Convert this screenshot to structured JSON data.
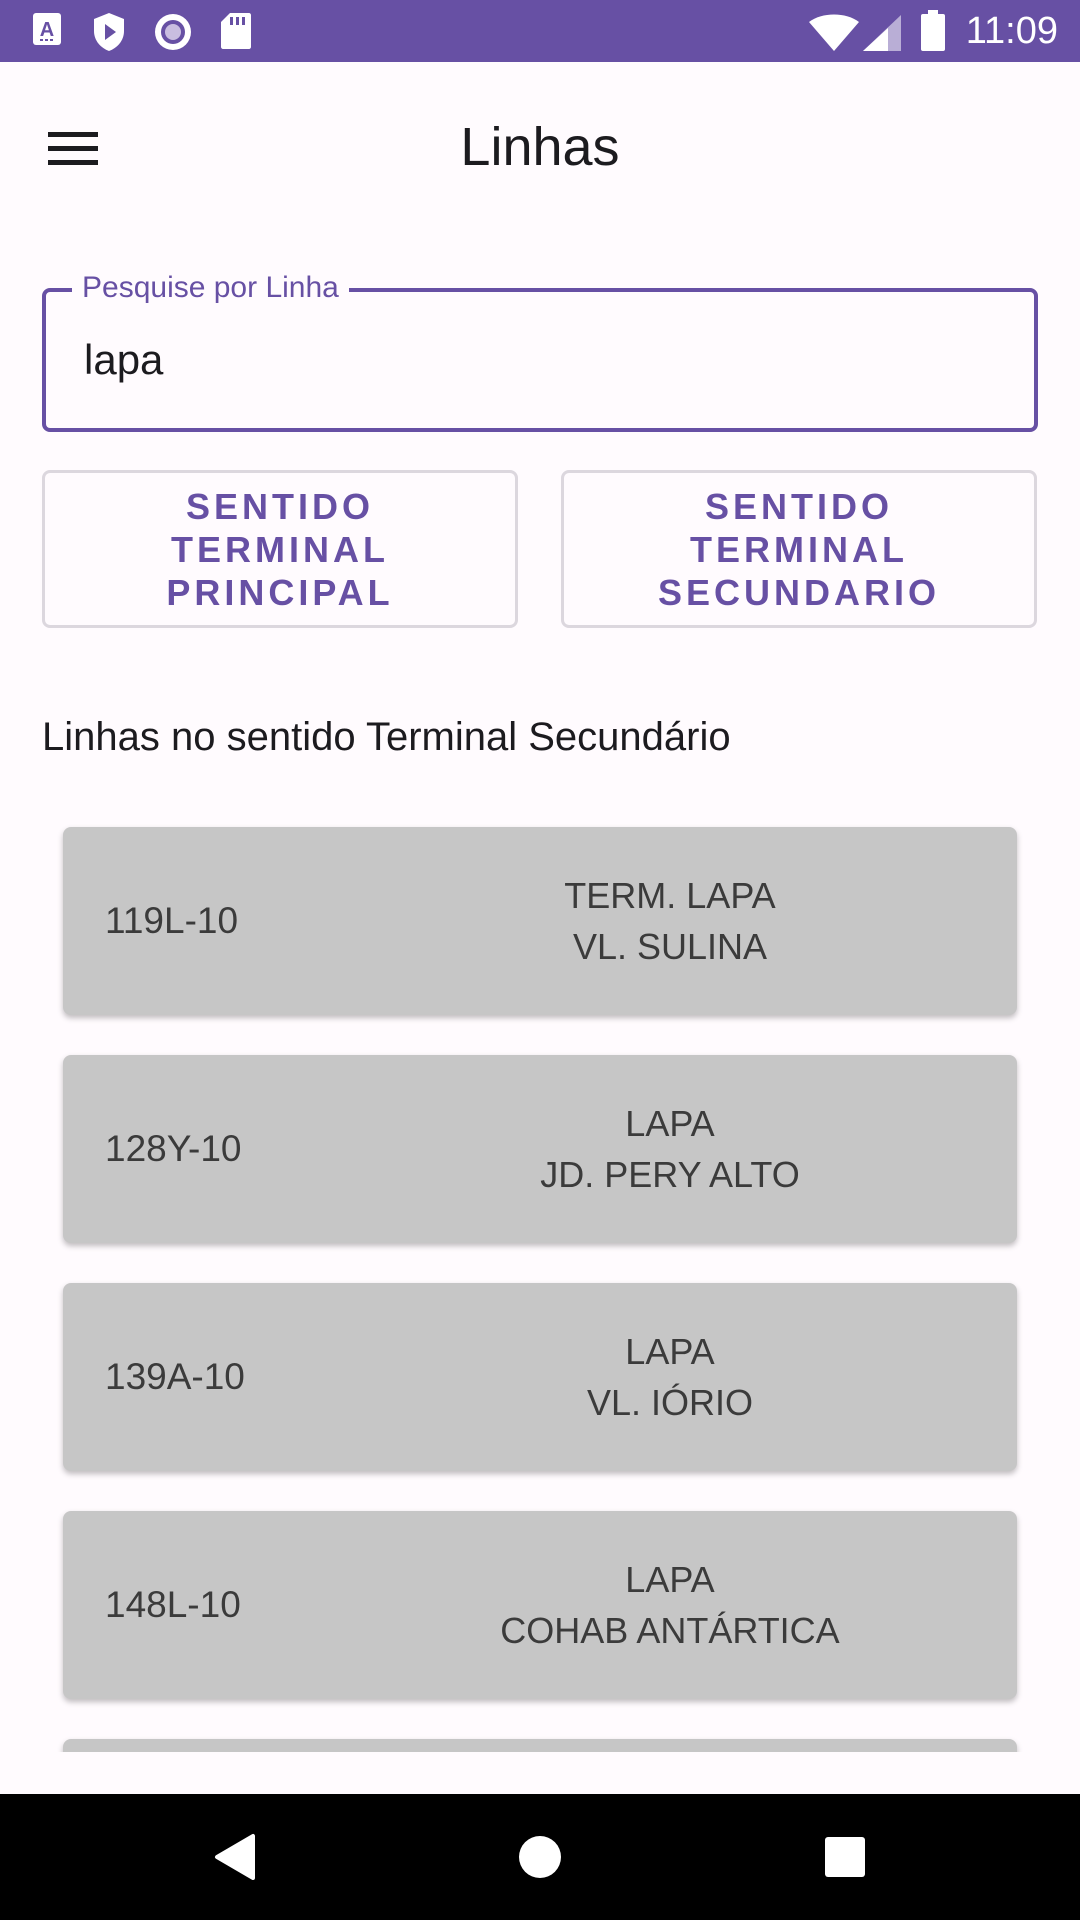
{
  "status_bar": {
    "time": "11:09",
    "left_icons": [
      "text-recognition-icon",
      "play-protect-icon",
      "circle-record-icon",
      "sd-card-icon"
    ],
    "right_icons": [
      "wifi-icon",
      "cellular-signal-icon",
      "battery-icon"
    ]
  },
  "app_bar": {
    "title": "Linhas",
    "menu_icon": "hamburger-menu-icon"
  },
  "search": {
    "label": "Pesquise por Linha",
    "value": "lapa"
  },
  "direction_buttons": {
    "principal": "SENTIDO\nTERMINAL\nPRINCIPAL",
    "secundario": "SENTIDO\nTERMINAL\nSECUNDARIO"
  },
  "section_heading": "Linhas no sentido Terminal Secundário",
  "lines": [
    {
      "code": "119L-10",
      "dest1": "TERM. LAPA",
      "dest2": "VL. SULINA"
    },
    {
      "code": "128Y-10",
      "dest1": "LAPA",
      "dest2": "JD. PERY ALTO"
    },
    {
      "code": "139A-10",
      "dest1": "LAPA",
      "dest2": "VL. IÓRIO"
    },
    {
      "code": "148L-10",
      "dest1": "LAPA",
      "dest2": "COHAB ANTÁRTICA"
    }
  ],
  "nav_bar": {
    "back_icon": "back-triangle-icon",
    "home_icon": "home-circle-icon",
    "recents_icon": "recents-square-icon"
  },
  "colors": {
    "primary": "#6750a4",
    "card": "#c6c6c6",
    "background": "#fffbfe"
  }
}
